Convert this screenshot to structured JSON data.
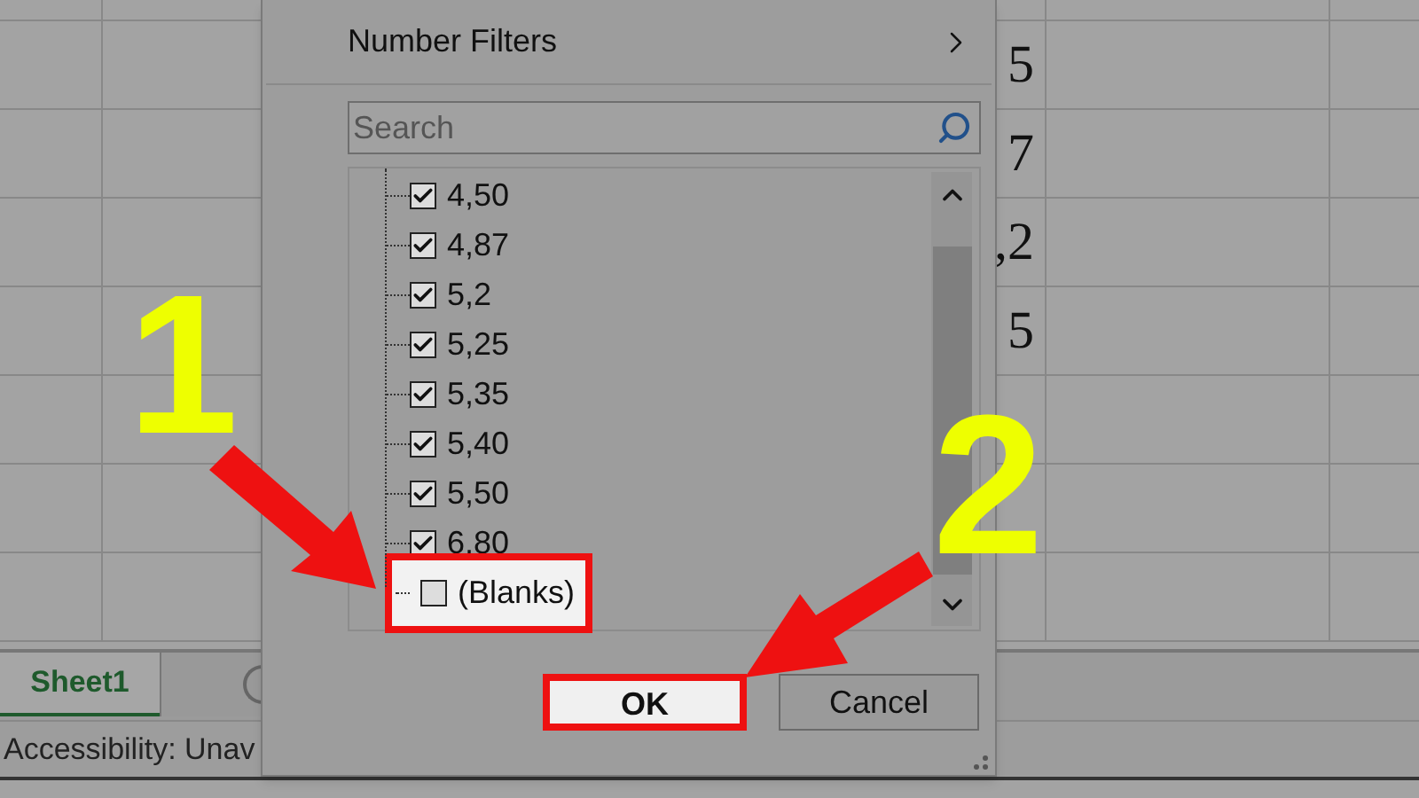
{
  "sheet": {
    "cells": [
      "5",
      "7",
      ",2",
      "5"
    ]
  },
  "filter_menu": {
    "title": "Number Filters",
    "search": {
      "placeholder": "Search"
    },
    "items": [
      {
        "label": "4,50",
        "checked": true,
        "highlighted": false
      },
      {
        "label": "4,87",
        "checked": true,
        "highlighted": false
      },
      {
        "label": "5,2",
        "checked": true,
        "highlighted": false
      },
      {
        "label": "5,25",
        "checked": true,
        "highlighted": false
      },
      {
        "label": "5,35",
        "checked": true,
        "highlighted": false
      },
      {
        "label": "5,40",
        "checked": true,
        "highlighted": false
      },
      {
        "label": "5,50",
        "checked": true,
        "highlighted": false
      },
      {
        "label": "6,80",
        "checked": true,
        "highlighted": false
      },
      {
        "label": "(Blanks)",
        "checked": false,
        "highlighted": true
      }
    ],
    "buttons": [
      {
        "label": "OK",
        "highlighted": true
      },
      {
        "label": "Cancel",
        "highlighted": false
      }
    ]
  },
  "tabs": [
    {
      "label": "Sheet1",
      "selected": true
    }
  ],
  "status_bar": "Accessibility: Unav",
  "annotations": [
    {
      "label": "1"
    },
    {
      "label": "2"
    }
  ]
}
